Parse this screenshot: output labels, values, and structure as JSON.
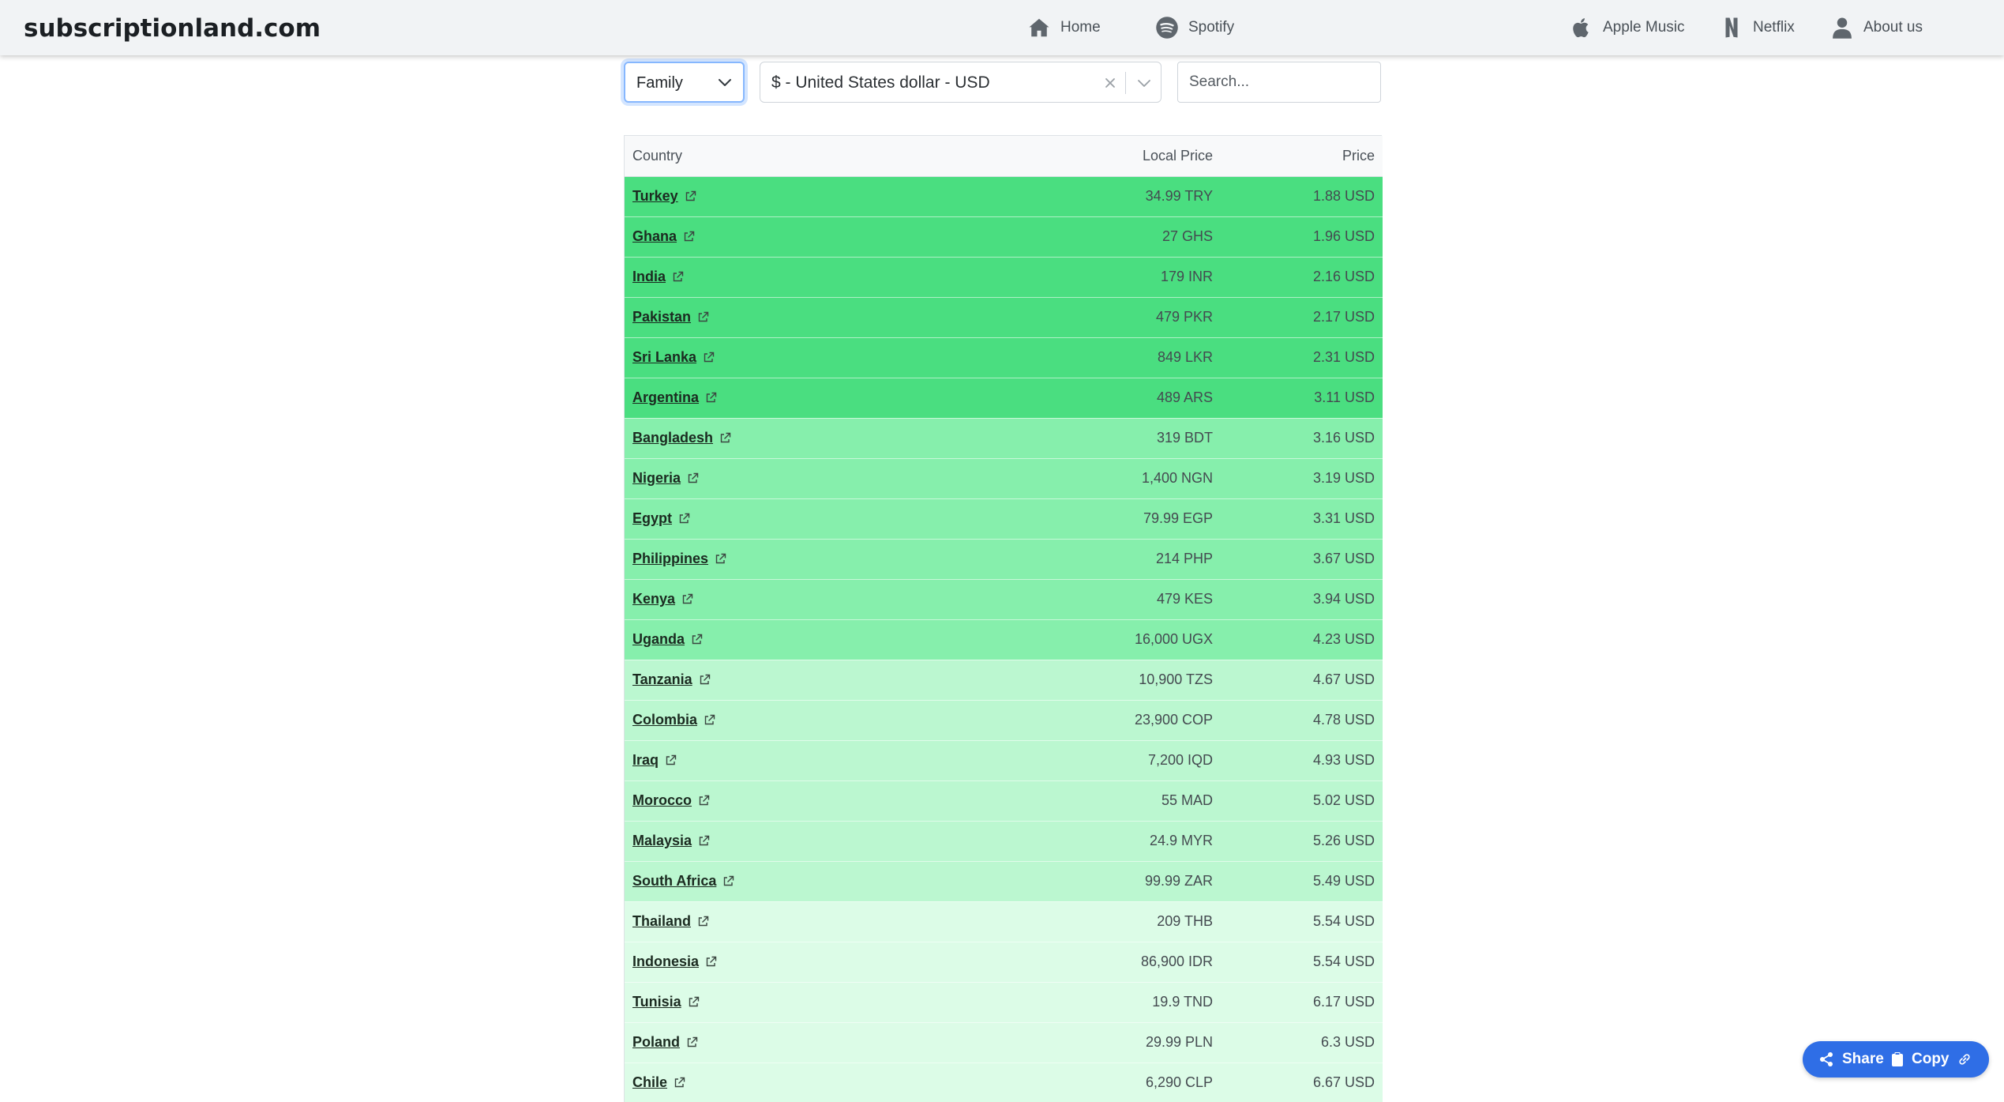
{
  "header": {
    "brand": "subscriptionland.com",
    "nav": [
      {
        "label": "Home",
        "icon": "home-icon"
      },
      {
        "label": "Spotify",
        "icon": "spotify-icon"
      },
      {
        "label": "Apple Music",
        "icon": "apple-icon"
      },
      {
        "label": "Netflix",
        "icon": "netflix-icon"
      },
      {
        "label": "About us",
        "icon": "user-icon"
      }
    ]
  },
  "filters": {
    "plan_selected": "Family",
    "currency_selected": "$ - United States dollar - USD",
    "search_placeholder": "Search..."
  },
  "table": {
    "headers": {
      "country": "Country",
      "local_price": "Local Price",
      "price": "Price"
    },
    "rows": [
      {
        "country": "Turkey",
        "local": "34.99 TRY",
        "price": "1.88 USD",
        "tier": 1
      },
      {
        "country": "Ghana",
        "local": "27 GHS",
        "price": "1.96 USD",
        "tier": 1
      },
      {
        "country": "India",
        "local": "179 INR",
        "price": "2.16 USD",
        "tier": 1
      },
      {
        "country": "Pakistan",
        "local": "479 PKR",
        "price": "2.17 USD",
        "tier": 1
      },
      {
        "country": "Sri Lanka",
        "local": "849 LKR",
        "price": "2.31 USD",
        "tier": 1
      },
      {
        "country": "Argentina",
        "local": "489 ARS",
        "price": "3.11 USD",
        "tier": 1
      },
      {
        "country": "Bangladesh",
        "local": "319 BDT",
        "price": "3.16 USD",
        "tier": 2
      },
      {
        "country": "Nigeria",
        "local": "1,400 NGN",
        "price": "3.19 USD",
        "tier": 2
      },
      {
        "country": "Egypt",
        "local": "79.99 EGP",
        "price": "3.31 USD",
        "tier": 2
      },
      {
        "country": "Philippines",
        "local": "214 PHP",
        "price": "3.67 USD",
        "tier": 2
      },
      {
        "country": "Kenya",
        "local": "479 KES",
        "price": "3.94 USD",
        "tier": 2
      },
      {
        "country": "Uganda",
        "local": "16,000 UGX",
        "price": "4.23 USD",
        "tier": 2
      },
      {
        "country": "Tanzania",
        "local": "10,900 TZS",
        "price": "4.67 USD",
        "tier": 3
      },
      {
        "country": "Colombia",
        "local": "23,900 COP",
        "price": "4.78 USD",
        "tier": 3
      },
      {
        "country": "Iraq",
        "local": "7,200 IQD",
        "price": "4.93 USD",
        "tier": 3
      },
      {
        "country": "Morocco",
        "local": "55 MAD",
        "price": "5.02 USD",
        "tier": 3
      },
      {
        "country": "Malaysia",
        "local": "24.9 MYR",
        "price": "5.26 USD",
        "tier": 3
      },
      {
        "country": "South Africa",
        "local": "99.99 ZAR",
        "price": "5.49 USD",
        "tier": 3
      },
      {
        "country": "Thailand",
        "local": "209 THB",
        "price": "5.54 USD",
        "tier": 4
      },
      {
        "country": "Indonesia",
        "local": "86,900 IDR",
        "price": "5.54 USD",
        "tier": 4
      },
      {
        "country": "Tunisia",
        "local": "19.9 TND",
        "price": "6.17 USD",
        "tier": 4
      },
      {
        "country": "Poland",
        "local": "29.99 PLN",
        "price": "6.3 USD",
        "tier": 4
      },
      {
        "country": "Chile",
        "local": "6,290 CLP",
        "price": "6.67 USD",
        "tier": 4
      }
    ]
  },
  "share": {
    "share_label": "Share",
    "copy_label": "Copy"
  },
  "colors": {
    "tier1": "#4ade80",
    "tier2": "#86efac",
    "tier3": "#bbf7d0",
    "tier4": "#dcfce7",
    "share_bg": "#2f6ee6",
    "navbar_bg": "#f1f3f5"
  }
}
